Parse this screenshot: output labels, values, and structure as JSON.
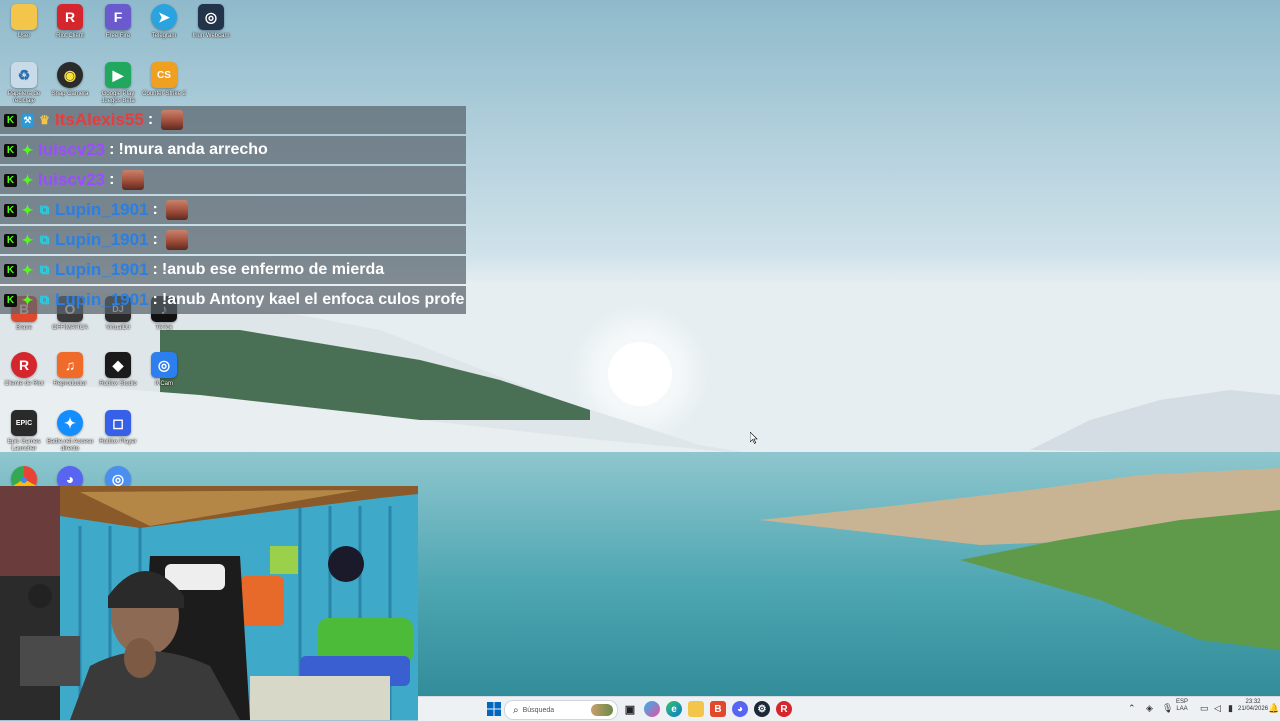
{
  "desktop": {
    "icons": [
      {
        "label": "User",
        "glyph": "",
        "color": "#f3c54a"
      },
      {
        "label": "Riot Client",
        "glyph": "R",
        "color": "#d4262c"
      },
      {
        "label": "Free Fire",
        "glyph": "F",
        "color": "#6a5acd"
      },
      {
        "label": "Telegram",
        "glyph": "➤",
        "color": "#2aa3df"
      },
      {
        "label": "Iriun Webcam",
        "glyph": "◎",
        "color": "#23344a"
      },
      {
        "label": "Papelera de reciclaje",
        "glyph": "♻",
        "color": "#c9dbe8"
      },
      {
        "label": "Snap Camera",
        "glyph": "◉",
        "color": "#2b2b2b"
      },
      {
        "label": "Google Play Juegos Beta",
        "glyph": "▶",
        "color": "#1fa85e"
      },
      {
        "label": "Counter-Strike 2",
        "glyph": "CS",
        "color": "#f0a020"
      },
      {
        "label": "Brave",
        "glyph": "B",
        "color": "#e0492b"
      },
      {
        "label": "OFFIMATICA",
        "glyph": "O",
        "color": "#3a3a3a"
      },
      {
        "label": "VirtualDJ",
        "glyph": "DJ",
        "color": "#2a2a2a"
      },
      {
        "label": "TikTok",
        "glyph": "♪",
        "color": "#111111"
      },
      {
        "label": "Cliente de Riot",
        "glyph": "R",
        "color": "#d4262c"
      },
      {
        "label": "Reproductor",
        "glyph": "♫",
        "color": "#f06a2a"
      },
      {
        "label": "Roblox Studio",
        "glyph": "◆",
        "color": "#1a1a1a"
      },
      {
        "label": "iVCam",
        "glyph": "◎",
        "color": "#2d7ff0"
      },
      {
        "label": "Epic Games Launcher",
        "glyph": "EPIC",
        "color": "#2a2a2a"
      },
      {
        "label": "Battle.net Acceso directo",
        "glyph": "✦",
        "color": "#148eff"
      },
      {
        "label": "Roblox Player",
        "glyph": "◻",
        "color": "#3760e8"
      },
      {
        "label": "",
        "glyph": "●",
        "color": "#ffffff"
      },
      {
        "label": "",
        "glyph": "◕",
        "color": "#5865f2"
      },
      {
        "label": "",
        "glyph": "◎",
        "color": "#4a8ef0"
      }
    ]
  },
  "chat": {
    "messages": [
      {
        "user": "ItsAlexis55",
        "user_color": "#e53c3c",
        "badges": [
          "kick",
          "tool",
          "crown"
        ],
        "text": "",
        "emote": true
      },
      {
        "user": "luiscv23",
        "user_color": "#9b4dff",
        "badges": [
          "kick",
          "gem"
        ],
        "text": "!mura anda arrecho",
        "emote": false
      },
      {
        "user": "luiscv23",
        "user_color": "#9b4dff",
        "badges": [
          "kick",
          "gem"
        ],
        "text": "",
        "emote": true
      },
      {
        "user": "Lupin_1901",
        "user_color": "#2a7fe0",
        "badges": [
          "kick",
          "gem",
          "sub"
        ],
        "text": "",
        "emote": true
      },
      {
        "user": "Lupin_1901",
        "user_color": "#2a7fe0",
        "badges": [
          "kick",
          "gem",
          "sub"
        ],
        "text": "",
        "emote": true
      },
      {
        "user": "Lupin_1901",
        "user_color": "#2a7fe0",
        "badges": [
          "kick",
          "gem",
          "sub"
        ],
        "text": "!anub ese enfermo de mierda",
        "emote": false
      },
      {
        "user": "Lupin_1901",
        "user_color": "#2a7fe0",
        "badges": [
          "kick",
          "gem",
          "sub"
        ],
        "text": "!anub Antony kael el enfoca culos profe",
        "emote": false
      }
    ],
    "separator": ":"
  },
  "taskbar": {
    "search_placeholder": "Búsqueda",
    "language_top": "ESP",
    "language_bottom": "LAA",
    "time": "23:32",
    "date": "21/04/2026",
    "accent": "#0067c0"
  }
}
